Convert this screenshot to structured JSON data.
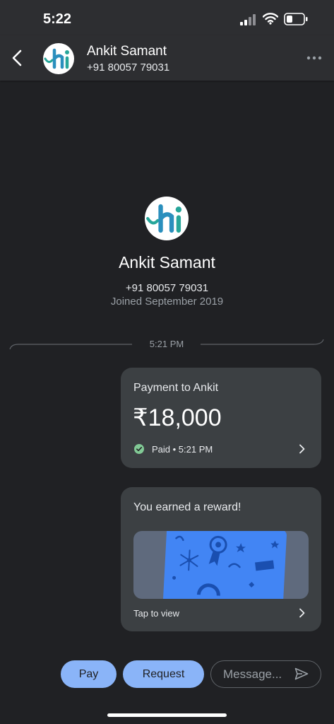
{
  "status_bar": {
    "time": "5:22"
  },
  "header": {
    "contact_name": "Ankit Samant",
    "contact_phone": "+91 80057 79031",
    "avatar_text": "hi"
  },
  "profile": {
    "name": "Ankit Samant",
    "phone": "+91 80057 79031",
    "joined": "Joined September 2019",
    "avatar_text": "hi"
  },
  "conversation": {
    "timestamp": "5:21 PM",
    "payment_card": {
      "title": "Payment to Ankit",
      "amount": "₹18,000",
      "status": "Paid • 5:21 PM"
    },
    "reward_card": {
      "title": "You earned a reward!",
      "cta": "Tap to view"
    }
  },
  "footer": {
    "pay_label": "Pay",
    "request_label": "Request",
    "message_placeholder": "Message..."
  },
  "colors": {
    "background": "#202124",
    "card": "#3c4043",
    "accent_button": "#8ab4f8",
    "paid_check": "#81c995",
    "reward_blue": "#4285f4"
  },
  "icons": {
    "back": "arrow-back-icon",
    "more": "more-horizontal-icon",
    "paid": "check-circle-icon",
    "chevron": "chevron-right-icon",
    "send": "send-icon"
  }
}
